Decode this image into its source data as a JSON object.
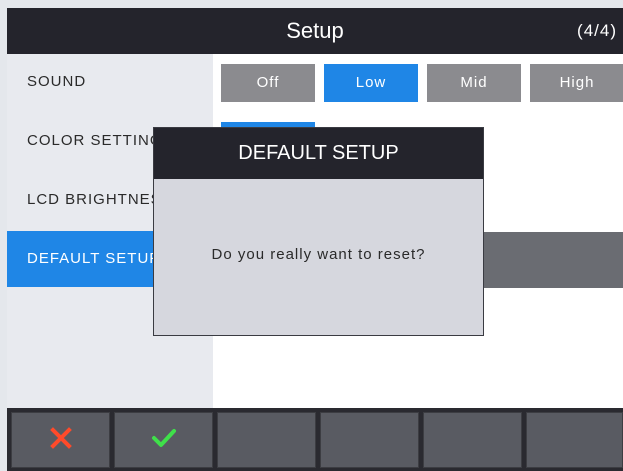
{
  "header": {
    "title": "Setup",
    "page": "(4/4)"
  },
  "menu": {
    "items": [
      {
        "label": "SOUND"
      },
      {
        "label": "COLOR SETTINGS"
      },
      {
        "label": "LCD BRIGHTNESS"
      },
      {
        "label": "DEFAULT SETUP"
      }
    ]
  },
  "sound_options": {
    "off": "Off",
    "low": "Low",
    "mid": "Mid",
    "high": "High",
    "selected": "Low"
  },
  "dialog": {
    "title": "DEFAULT SETUP",
    "message": "Do you really want to reset?"
  },
  "bottom_bar": {
    "cancel_icon": "close-icon",
    "confirm_icon": "check-icon"
  },
  "colors": {
    "accent": "#1f86e6",
    "header_bg": "#24242c",
    "cancel_red": "#ff4a2a",
    "confirm_green": "#3fe04a"
  }
}
